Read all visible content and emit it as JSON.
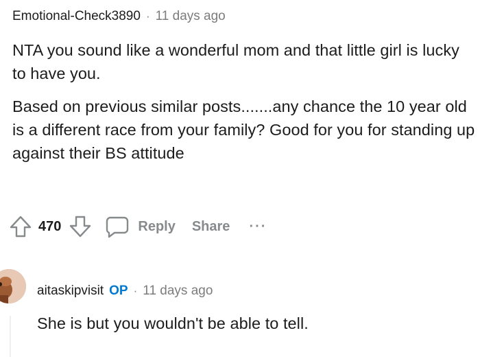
{
  "comment1": {
    "username": "Emotional-Check3890",
    "separator": "·",
    "time": "11 days ago",
    "paragraphs": [
      "NTA you sound like a wonderful mom and that little girl is lucky to have you.",
      "Based on previous similar posts.......any chance the 10 year old is a different race from your family? Good for you for standing up against their BS attitude"
    ]
  },
  "actions": {
    "upvote_icon": "upvote-arrow-icon",
    "vote_count": "470",
    "downvote_icon": "downvote-arrow-icon",
    "reply_icon": "speech-bubble-icon",
    "reply_label": "Reply",
    "share_label": "Share",
    "more_label": "···"
  },
  "comment2": {
    "username": "aitaskipvisit",
    "op_badge": "OP",
    "separator": "·",
    "time": "11 days ago",
    "text": "She is but you wouldn't be able to tell."
  },
  "colors": {
    "text": "#1c1c1c",
    "meta": "#7c7c7c",
    "action": "#878a8c",
    "op": "#0079d3"
  }
}
